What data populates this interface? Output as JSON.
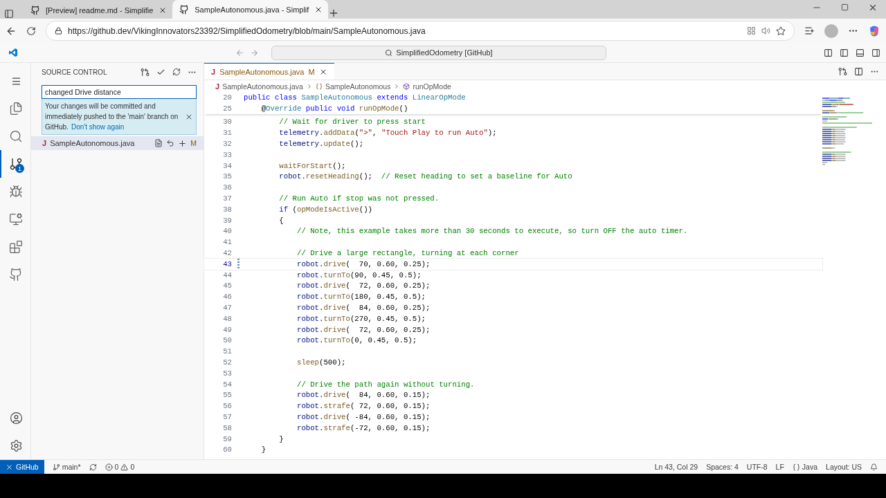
{
  "browser": {
    "tabs": [
      {
        "title": "[Preview] readme.md - Simplifie",
        "selected": false
      },
      {
        "title": "SampleAutonomous.java - Simplif",
        "selected": true
      }
    ],
    "url": "https://github.dev/VikingInnovators23392/SimplifiedOdometry/blob/main/SampleAutonomous.java"
  },
  "command_center": "SimplifiedOdometry [GitHub]",
  "activity_bar": [
    {
      "kind": "explorer",
      "selected": false
    },
    {
      "kind": "search",
      "selected": false
    },
    {
      "kind": "scm",
      "selected": true,
      "badge": "1"
    },
    {
      "kind": "debug",
      "selected": false
    },
    {
      "kind": "remote",
      "selected": false
    },
    {
      "kind": "extensions",
      "selected": false
    },
    {
      "kind": "github",
      "selected": false
    }
  ],
  "sidebar": {
    "title": "SOURCE CONTROL",
    "commit_message": "changed Drive distance",
    "notice": "Your changes will be committed and immediately pushed to the 'main' branch on GitHub.",
    "notice_link": "Don't show again",
    "changes": [
      {
        "icon": "J",
        "name": "SampleAutonomous.java",
        "status": "M"
      }
    ]
  },
  "editor": {
    "tab": {
      "icon": "J",
      "label": "SampleAutonomous.java",
      "status": "M"
    },
    "breadcrumbs": [
      {
        "kind": "file",
        "icon": "J",
        "label": "SampleAutonomous.java"
      },
      {
        "kind": "class",
        "label": "SampleAutonomous"
      },
      {
        "kind": "method",
        "label": "runOpMode"
      }
    ],
    "sticky": [
      {
        "n": "20",
        "code": [
          {
            "kind": "kw",
            "text": "public class "
          },
          {
            "kind": "type",
            "text": "SampleAutonomous"
          },
          {
            "kind": "kw",
            "text": " extends "
          },
          {
            "kind": "type",
            "text": "LinearOpMode"
          }
        ]
      },
      {
        "n": "25",
        "code": [
          {
            "kind": "plain",
            "text": "    @"
          },
          {
            "kind": "type",
            "text": "Override"
          },
          {
            "kind": "kw",
            "text": " public void "
          },
          {
            "kind": "fn",
            "text": "runOpMode"
          },
          {
            "kind": "plain",
            "text": "()"
          }
        ]
      }
    ],
    "lines": [
      {
        "n": "30",
        "current": false,
        "modified": false,
        "code": [
          {
            "kind": "cmt",
            "text": "        // Wait for driver to press start"
          }
        ]
      },
      {
        "n": "31",
        "current": false,
        "modified": false,
        "code": [
          {
            "kind": "var",
            "text": "        telemetry"
          },
          {
            "kind": "plain",
            "text": "."
          },
          {
            "kind": "fn",
            "text": "addData"
          },
          {
            "kind": "plain",
            "text": "("
          },
          {
            "kind": "str",
            "text": "\">\""
          },
          {
            "kind": "plain",
            "text": ", "
          },
          {
            "kind": "str",
            "text": "\"Touch Play to run Auto\""
          },
          {
            "kind": "plain",
            "text": ");"
          }
        ]
      },
      {
        "n": "32",
        "current": false,
        "modified": false,
        "code": [
          {
            "kind": "var",
            "text": "        telemetry"
          },
          {
            "kind": "plain",
            "text": "."
          },
          {
            "kind": "fn",
            "text": "update"
          },
          {
            "kind": "plain",
            "text": "();"
          }
        ]
      },
      {
        "n": "33",
        "current": false,
        "modified": false
      },
      {
        "n": "34",
        "current": false,
        "modified": false,
        "code": [
          {
            "kind": "fn",
            "text": "        waitForStart"
          },
          {
            "kind": "plain",
            "text": "();"
          }
        ]
      },
      {
        "n": "35",
        "current": false,
        "modified": false,
        "code": [
          {
            "kind": "var",
            "text": "        robot"
          },
          {
            "kind": "plain",
            "text": "."
          },
          {
            "kind": "fn",
            "text": "resetHeading"
          },
          {
            "kind": "plain",
            "text": "();  "
          },
          {
            "kind": "cmt",
            "text": "// Reset heading to set a baseline for Auto"
          }
        ]
      },
      {
        "n": "36",
        "current": false,
        "modified": false
      },
      {
        "n": "37",
        "current": false,
        "modified": false,
        "code": [
          {
            "kind": "cmt",
            "text": "        // Run Auto if stop was not pressed."
          }
        ]
      },
      {
        "n": "38",
        "current": false,
        "modified": false,
        "code": [
          {
            "kind": "kw",
            "text": "        if"
          },
          {
            "kind": "plain",
            "text": " ("
          },
          {
            "kind": "fn",
            "text": "opModeIsActive"
          },
          {
            "kind": "plain",
            "text": "())"
          }
        ]
      },
      {
        "n": "39",
        "current": false,
        "modified": false,
        "code": [
          {
            "kind": "plain",
            "text": "        {"
          }
        ]
      },
      {
        "n": "40",
        "current": false,
        "modified": false,
        "code": [
          {
            "kind": "cmt",
            "text": "            // Note, this example takes more than 30 seconds to execute, so turn OFF the auto timer."
          }
        ]
      },
      {
        "n": "41",
        "current": false,
        "modified": false
      },
      {
        "n": "42",
        "current": false,
        "modified": false,
        "code": [
          {
            "kind": "cmt",
            "text": "            // Drive a large rectangle, turning at each corner"
          }
        ]
      },
      {
        "n": "43",
        "current": true,
        "modified": true,
        "code": [
          {
            "kind": "var",
            "text": "            robot"
          },
          {
            "kind": "plain",
            "text": "."
          },
          {
            "kind": "fn",
            "text": "drive"
          },
          {
            "kind": "plain",
            "text": "(  70, 0.60, 0.25);"
          }
        ]
      },
      {
        "n": "44",
        "current": false,
        "modified": false,
        "code": [
          {
            "kind": "var",
            "text": "            robot"
          },
          {
            "kind": "plain",
            "text": "."
          },
          {
            "kind": "fn",
            "text": "turnTo"
          },
          {
            "kind": "plain",
            "text": "(90, 0.45, 0.5);"
          }
        ]
      },
      {
        "n": "45",
        "current": false,
        "modified": false,
        "code": [
          {
            "kind": "var",
            "text": "            robot"
          },
          {
            "kind": "plain",
            "text": "."
          },
          {
            "kind": "fn",
            "text": "drive"
          },
          {
            "kind": "plain",
            "text": "(  72, 0.60, 0.25);"
          }
        ]
      },
      {
        "n": "46",
        "current": false,
        "modified": false,
        "code": [
          {
            "kind": "var",
            "text": "            robot"
          },
          {
            "kind": "plain",
            "text": "."
          },
          {
            "kind": "fn",
            "text": "turnTo"
          },
          {
            "kind": "plain",
            "text": "(180, 0.45, 0.5);"
          }
        ]
      },
      {
        "n": "47",
        "current": false,
        "modified": false,
        "code": [
          {
            "kind": "var",
            "text": "            robot"
          },
          {
            "kind": "plain",
            "text": "."
          },
          {
            "kind": "fn",
            "text": "drive"
          },
          {
            "kind": "plain",
            "text": "(  84, 0.60, 0.25);"
          }
        ]
      },
      {
        "n": "48",
        "current": false,
        "modified": false,
        "code": [
          {
            "kind": "var",
            "text": "            robot"
          },
          {
            "kind": "plain",
            "text": "."
          },
          {
            "kind": "fn",
            "text": "turnTo"
          },
          {
            "kind": "plain",
            "text": "(270, 0.45, 0.5);"
          }
        ]
      },
      {
        "n": "49",
        "current": false,
        "modified": false,
        "code": [
          {
            "kind": "var",
            "text": "            robot"
          },
          {
            "kind": "plain",
            "text": "."
          },
          {
            "kind": "fn",
            "text": "drive"
          },
          {
            "kind": "plain",
            "text": "(  72, 0.60, 0.25);"
          }
        ]
      },
      {
        "n": "50",
        "current": false,
        "modified": false,
        "code": [
          {
            "kind": "var",
            "text": "            robot"
          },
          {
            "kind": "plain",
            "text": "."
          },
          {
            "kind": "fn",
            "text": "turnTo"
          },
          {
            "kind": "plain",
            "text": "(0, 0.45, 0.5);"
          }
        ]
      },
      {
        "n": "51",
        "current": false,
        "modified": false
      },
      {
        "n": "52",
        "current": false,
        "modified": false,
        "code": [
          {
            "kind": "fn",
            "text": "            sleep"
          },
          {
            "kind": "plain",
            "text": "(500);"
          }
        ]
      },
      {
        "n": "53",
        "current": false,
        "modified": false
      },
      {
        "n": "54",
        "current": false,
        "modified": false,
        "code": [
          {
            "kind": "cmt",
            "text": "            // Drive the path again without turning."
          }
        ]
      },
      {
        "n": "55",
        "current": false,
        "modified": false,
        "code": [
          {
            "kind": "var",
            "text": "            robot"
          },
          {
            "kind": "plain",
            "text": "."
          },
          {
            "kind": "fn",
            "text": "drive"
          },
          {
            "kind": "plain",
            "text": "(  84, 0.60, 0.15);"
          }
        ]
      },
      {
        "n": "56",
        "current": false,
        "modified": false,
        "code": [
          {
            "kind": "var",
            "text": "            robot"
          },
          {
            "kind": "plain",
            "text": "."
          },
          {
            "kind": "fn",
            "text": "strafe"
          },
          {
            "kind": "plain",
            "text": "( 72, 0.60, 0.15);"
          }
        ]
      },
      {
        "n": "57",
        "current": false,
        "modified": false,
        "code": [
          {
            "kind": "var",
            "text": "            robot"
          },
          {
            "kind": "plain",
            "text": "."
          },
          {
            "kind": "fn",
            "text": "drive"
          },
          {
            "kind": "plain",
            "text": "( -84, 0.60, 0.15);"
          }
        ]
      },
      {
        "n": "58",
        "current": false,
        "modified": false,
        "code": [
          {
            "kind": "var",
            "text": "            robot"
          },
          {
            "kind": "plain",
            "text": "."
          },
          {
            "kind": "fn",
            "text": "strafe"
          },
          {
            "kind": "plain",
            "text": "(-72, 0.60, 0.15);"
          }
        ]
      },
      {
        "n": "59",
        "current": false,
        "modified": false,
        "code": [
          {
            "kind": "plain",
            "text": "        }"
          }
        ]
      },
      {
        "n": "60",
        "current": false,
        "modified": false,
        "code": [
          {
            "kind": "plain",
            "text": "    }"
          }
        ]
      }
    ]
  },
  "status_bar": {
    "remote": "GitHub",
    "branch": "main*",
    "errors": "0",
    "warnings": "0",
    "right": [
      {
        "kind": "text",
        "text": "Ln 43, Col 29"
      },
      {
        "kind": "text",
        "text": "Spaces: 4"
      },
      {
        "kind": "text",
        "text": "UTF-8"
      },
      {
        "kind": "text",
        "text": "LF"
      },
      {
        "kind": "language",
        "text": "Java"
      },
      {
        "kind": "text",
        "text": "Layout: US"
      }
    ]
  }
}
